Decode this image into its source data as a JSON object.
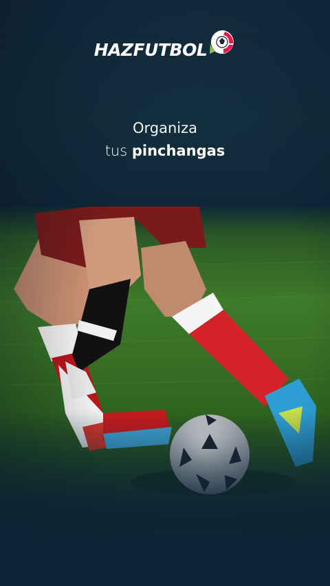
{
  "brand": {
    "name": "HAZFUTBOL",
    "colors": {
      "background": "#0d2436",
      "ball_green": "#8cc63f",
      "ball_red": "#e6194b",
      "text": "#ffffff"
    }
  },
  "tagline": {
    "line1": "Organiza",
    "line2_prefix": "tus",
    "line2_bold": "pinchangas"
  },
  "icons": {
    "logo_mark": "soccer-ball-speech-bubble-icon"
  }
}
